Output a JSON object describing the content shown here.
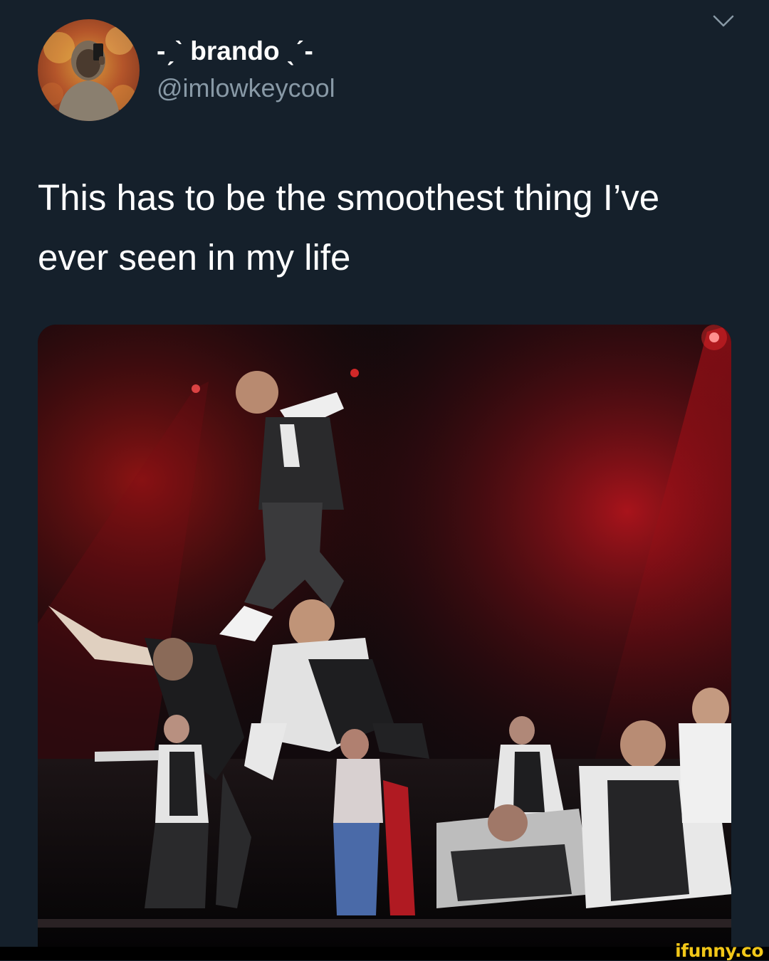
{
  "tweet": {
    "display_name": "-ˏˋ brando ˎˊ-",
    "handle": "@imlowkeycool",
    "text": "This has to be the smoothest thing I’ve\never seen in my life",
    "menu_icon": "chevron-down-icon",
    "avatar_icon": "user-avatar",
    "media_icon": "video-thumbnail"
  },
  "watermark": {
    "text": "ifunny.co"
  },
  "colors": {
    "background": "#15202b",
    "secondary_text": "#8899a6",
    "watermark": "#f2c718"
  }
}
